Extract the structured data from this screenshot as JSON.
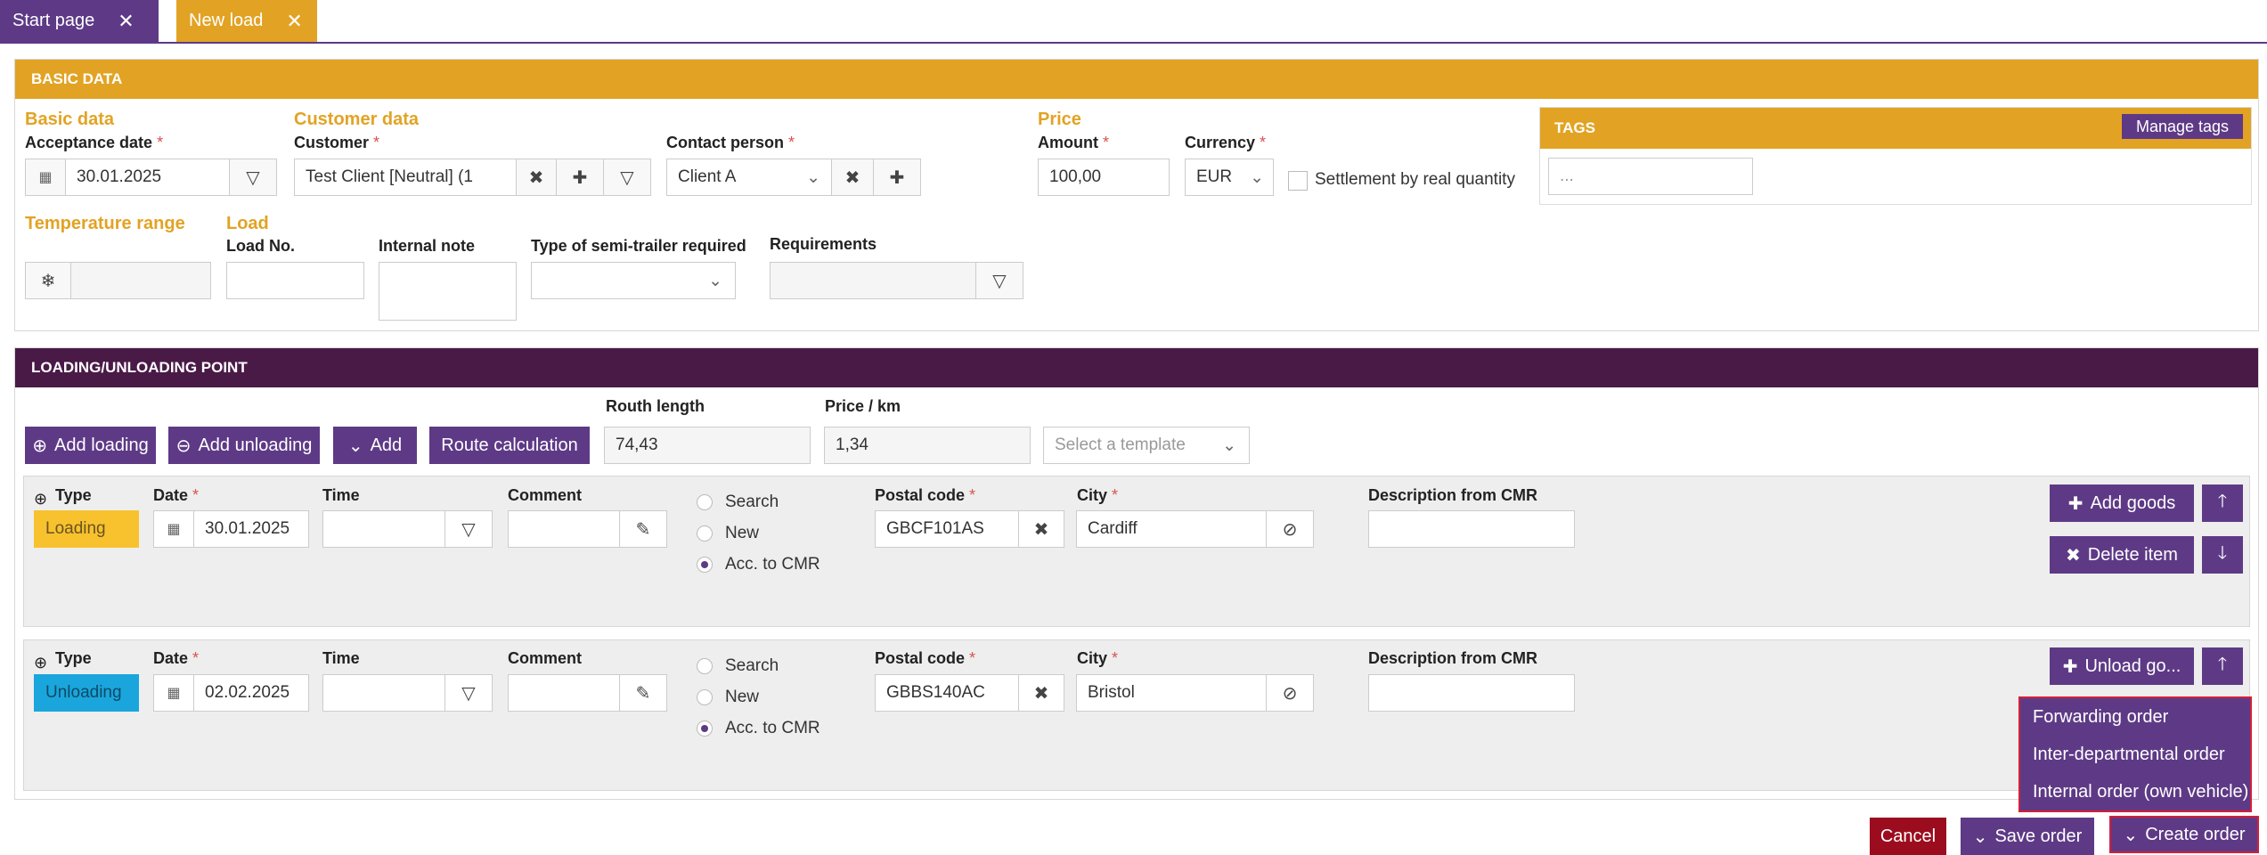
{
  "tabs": [
    {
      "label": "Start page",
      "close": "✕",
      "color": "#5e3a86"
    },
    {
      "label": "New load",
      "close": "✕",
      "color": "#e2a324"
    }
  ],
  "basic": {
    "header": "BASIC DATA",
    "sec_basic": "Basic data",
    "sec_customer": "Customer data",
    "sec_price": "Price",
    "sec_temperature": "Temperature range",
    "sec_load": "Load",
    "acceptance_label": "Acceptance date",
    "acceptance_value": "30.01.2025",
    "customer_label": "Customer",
    "customer_value": "Test Client [Neutral] (1",
    "contact_label": "Contact person",
    "contact_value": "Client A",
    "amount_label": "Amount",
    "amount_value": "100,00",
    "currency_label": "Currency",
    "currency_value": "EUR",
    "settlement_label": "Settlement by real quantity",
    "load_no_label": "Load No.",
    "internal_note_label": "Internal note",
    "semitrailer_label": "Type of semi-trailer required",
    "requirements_label": "Requirements"
  },
  "tags": {
    "header": "TAGS",
    "manage_label": "Manage tags",
    "placeholder": "..."
  },
  "loading": {
    "header": "LOADING/UNLOADING POINT",
    "add_loading": "Add loading",
    "add_unloading": "Add unloading",
    "add": "Add",
    "route_calc": "Route calculation",
    "route_length_label": "Routh length",
    "route_length_value": "74,43",
    "price_km_label": "Price / km",
    "price_km_value": "1,34",
    "template_placeholder": "Select a template"
  },
  "columns": {
    "type": "Type",
    "date": "Date",
    "time": "Time",
    "comment": "Comment",
    "postal": "Postal code",
    "city": "City",
    "desc": "Description from CMR",
    "radio_search": "Search",
    "radio_new": "New",
    "radio_cmr": "Acc. to CMR"
  },
  "points": [
    {
      "type": "Loading",
      "type_color": "#f7c22e",
      "date": "30.01.2025",
      "postal": "GBCF101AS",
      "city": "Cardiff",
      "action1": "Add goods",
      "action2": "Delete item"
    },
    {
      "type": "Unloading",
      "type_color": "#1aa6dc",
      "date": "02.02.2025",
      "postal": "GBBS140AC",
      "city": "Bristol",
      "action1": "Unload go..."
    }
  ],
  "dropdown": {
    "items": [
      "Forwarding order",
      "Inter-departmental order",
      "Internal order (own vehicle)"
    ]
  },
  "footer": {
    "cancel": "Cancel",
    "save": "Save order",
    "create": "Create order"
  },
  "colors": {
    "purple": "#5e3a86",
    "orange": "#e2a324",
    "dark_purple": "#4a1a47",
    "cancel_red": "#9b0d1e",
    "highlight_red": "#d41f3a"
  }
}
